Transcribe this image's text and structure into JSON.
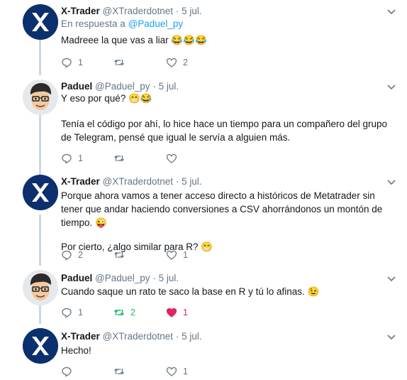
{
  "tweets": [
    {
      "name": "X-Trader",
      "handle": "@XTraderdotnet",
      "sep": "·",
      "time": "5 jul.",
      "reply_prefix": "En respuesta a",
      "reply_handle": "@Paduel_py",
      "text": [
        "Madreee la que vas a liar 😂😂😂"
      ],
      "reply_count": "1",
      "retweet_count": "",
      "like_count": "2"
    },
    {
      "name": "Paduel",
      "handle": "@Paduel_py",
      "sep": "·",
      "time": "5 jul.",
      "text": [
        "Y eso por qué? 😁😂",
        "Tenía el código por ahí, lo hice hace un tiempo para un compañero del grupo de Telegram, pensé que igual le servía a alguien más."
      ],
      "reply_count": "1",
      "retweet_count": "",
      "like_count": ""
    },
    {
      "name": "X-Trader",
      "handle": "@XTraderdotnet",
      "sep": "·",
      "time": "5 jul.",
      "text": [
        "Porque ahora vamos a tener acceso directo a históricos de Metatrader sin tener que andar haciendo conversiones a CSV ahorrándonos un montón de tiempo. 😜",
        "Por cierto, ¿algo similar para R? 😁"
      ],
      "reply_count": "2",
      "retweet_count": "",
      "like_count": "1"
    },
    {
      "name": "Paduel",
      "handle": "@Paduel_py",
      "sep": "·",
      "time": "5 jul.",
      "text": [
        "Cuando saque un rato te saco la base en R y tú lo afinas. 😉"
      ],
      "reply_count": "1",
      "retweet_count": "2",
      "like_count": "1"
    },
    {
      "name": "X-Trader",
      "handle": "@XTraderdotnet",
      "sep": "·",
      "time": "5 jul.",
      "text": [
        "Hecho!"
      ],
      "reply_count": "",
      "retweet_count": "",
      "like_count": "1"
    }
  ],
  "icons": {
    "avatar_x": "x-logo-avatar",
    "avatar_paduel": "cartoon-face-avatar",
    "reply": "reply-icon",
    "retweet": "retweet-icon",
    "like": "heart-icon",
    "menu": "chevron-down-icon"
  },
  "colors": {
    "link": "#1da1f2",
    "muted": "#657786",
    "retweet_active": "#17bf63",
    "like_active": "#e0245e",
    "thread_line": "#ccd6dd",
    "xtrader_avatar_bg": "#0c2f6e"
  }
}
